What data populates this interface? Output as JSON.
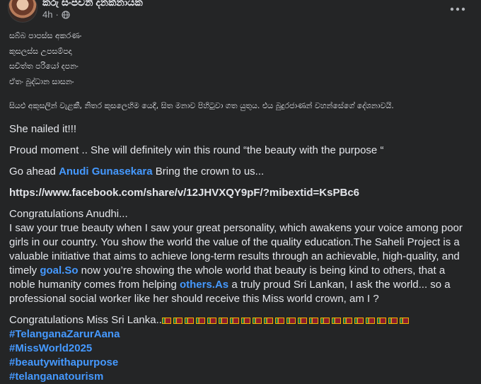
{
  "post": {
    "author": "කරු සංජවනි දනක්නායක",
    "time": "4h",
    "dot": "·",
    "more_icon": "more-horizontal-icon",
    "privacy_icon": "globe-icon"
  },
  "sinhala_lines": [
    "සබ්බ පාපස්ස අකරණං",
    "කුසලස්ස උපසම්පදා",
    "සචිත්ත පරියෝ දපනං",
    "ඒතං බුද්ධාන සාසනං"
  ],
  "sinhala_para": "සියළු අකුසලින් වැළකී, නිතර කුසලෙහිම යෙදී, සිත මනාව පිහිටුවා ගත යුතුය. එය බුදුරජාණන් වහන්සේගේ දේශනාවයි.",
  "nailed": "She nailed it!!!",
  "proud": "Proud moment .. She will definitely win this round “the beauty with the purpose “",
  "go_ahead": {
    "prefix": "Go ahead ",
    "name": "Anudi Gunasekara",
    "suffix": "  Bring the crown to us..."
  },
  "share_url": "https://www.facebook.com/share/v/12JHVXQY9pF/?mibextid=KsPBc6",
  "congrats_heading": "Congratulations Anudhi...",
  "long_para": {
    "part1": "I saw your true beauty when I saw your great personality, which awakens your voice among poor girls in our country. You show the world the value of the quality education.The Saheli Project is a valuable initiative that aims to achieve long-term results through an achievable, high-quality, and timely ",
    "link1": "goal.So",
    "part2": " now you’re showing the whole world that beauty is being kind to others, that a noble humanity comes from helping ",
    "link2": "others.As",
    "part3": " a truly proud Sri Lankan, I ask the world... so a professional social worker like her should receive this Miss world crown, am I ?"
  },
  "congrats_sl": "Congratulations Miss Sri Lanka..",
  "flag_count": 22,
  "flag_icon": "sri-lanka-flag-icon",
  "hashtags": [
    "#TelanganaZarurAana",
    "#MissWorld2025",
    "#beautywithapurpose",
    "#telanganatourism"
  ]
}
